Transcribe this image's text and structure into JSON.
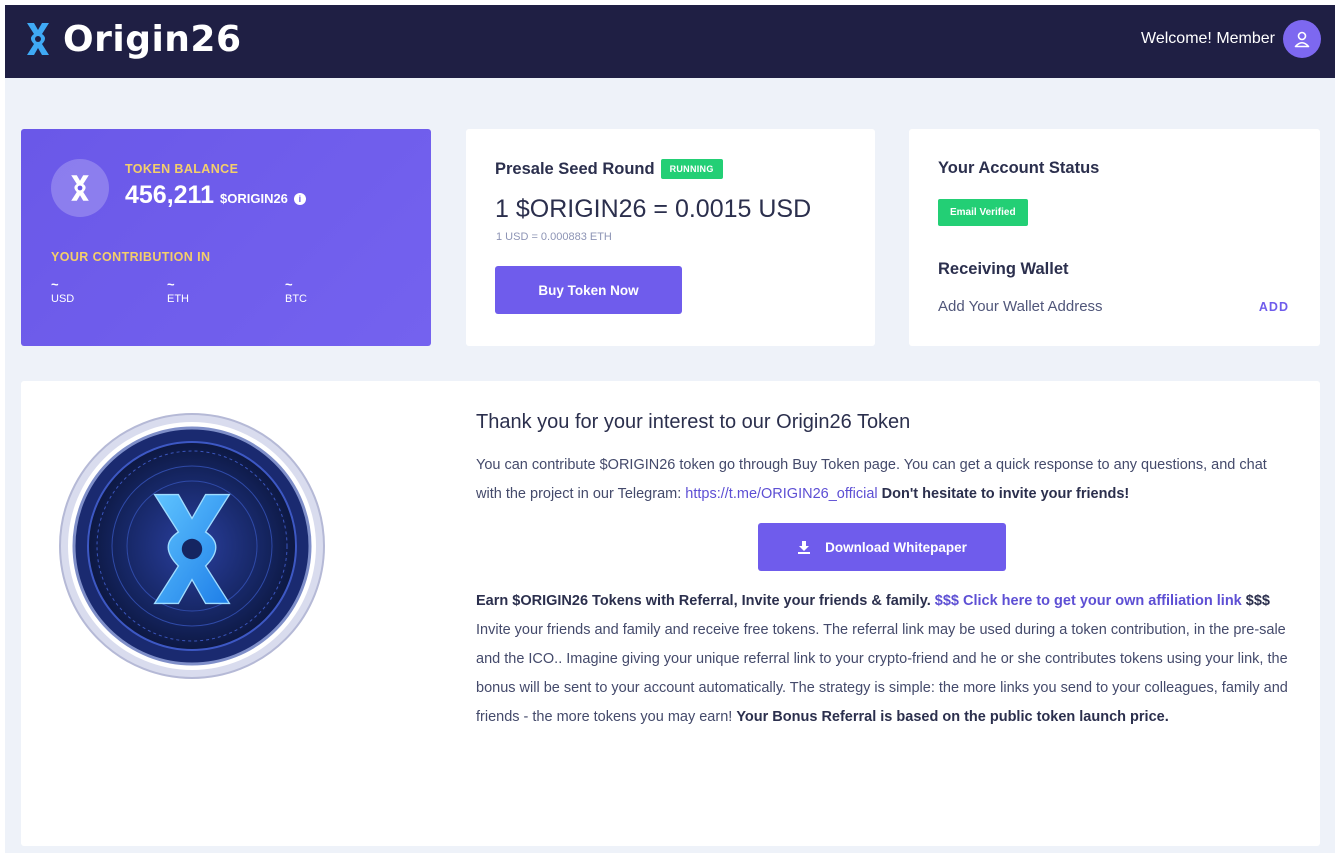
{
  "header": {
    "brand": "Origin26",
    "welcome": "Welcome! Member",
    "avatar_icon": "user-icon"
  },
  "balance": {
    "label": "TOKEN BALANCE",
    "amount": "456,211",
    "unit": "$ORIGIN26",
    "info_icon": "i",
    "contribution_label": "YOUR CONTRIBUTION IN",
    "contributions": [
      {
        "value": "~",
        "currency": "USD"
      },
      {
        "value": "~",
        "currency": "ETH"
      },
      {
        "value": "~",
        "currency": "BTC"
      }
    ]
  },
  "presale": {
    "title": "Presale Seed Round",
    "status": "RUNNING",
    "price": "1 $ORIGIN26 = 0.0015 USD",
    "rate": "1 USD = 0.000883 ETH",
    "buy_label": "Buy Token Now"
  },
  "account": {
    "title": "Your Account Status",
    "email_badge": "Email Verified",
    "wallet_title": "Receiving Wallet",
    "wallet_desc": "Add Your Wallet Address",
    "add_label": "ADD"
  },
  "info": {
    "title": "Thank you for your interest to our Origin26 Token",
    "para_text": "You can contribute $ORIGIN26 token go through Buy Token page. You can get a quick response to any questions, and chat with the project in our Telegram: ",
    "telegram_link": "https://t.me/ORIGIN26_official",
    "para_bold": "Don't hesitate to invite your friends!",
    "download_label": "Download Whitepaper",
    "ref_text": "Earn $ORIGIN26 Tokens with Referral, Invite your friends & family.",
    "ref_link": "$$$ Click here to get your own affiliation link",
    "ref_tail": "$$$",
    "ref_para": "Invite your friends and family and receive free tokens. The referral link may be used during a token contribution, in the pre-sale and the ICO.. Imagine giving your unique referral link to your crypto-friend and he or she contributes tokens using your link, the bonus will be sent to your account automatically. The strategy is simple: the more links you send to your colleagues, family and friends - the more tokens you may earn!",
    "ref_para_bold": "Your Bonus Referral is based on the public token launch price."
  },
  "colors": {
    "navbar": "#1f1f44",
    "accent": "#6f5cec",
    "success": "#23cf75",
    "gold": "#f4cf6a",
    "background": "#eef2f9"
  }
}
